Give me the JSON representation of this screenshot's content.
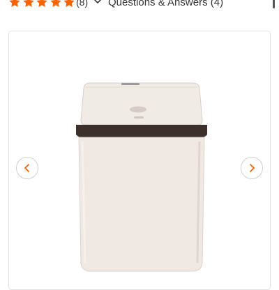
{
  "rating": {
    "stars": 5,
    "count_text": "(8)"
  },
  "qa": {
    "label": "Questions & Answers (4)"
  },
  "colors": {
    "star": "#f96302",
    "nav_arrow": "#f96302",
    "can_body": "#efe8e3",
    "can_band": "#3d2f2a"
  },
  "icons": {
    "star": "star-icon",
    "qa_toggle": "chevron-down-icon",
    "prev": "chevron-left-icon",
    "next": "chevron-right-icon"
  }
}
